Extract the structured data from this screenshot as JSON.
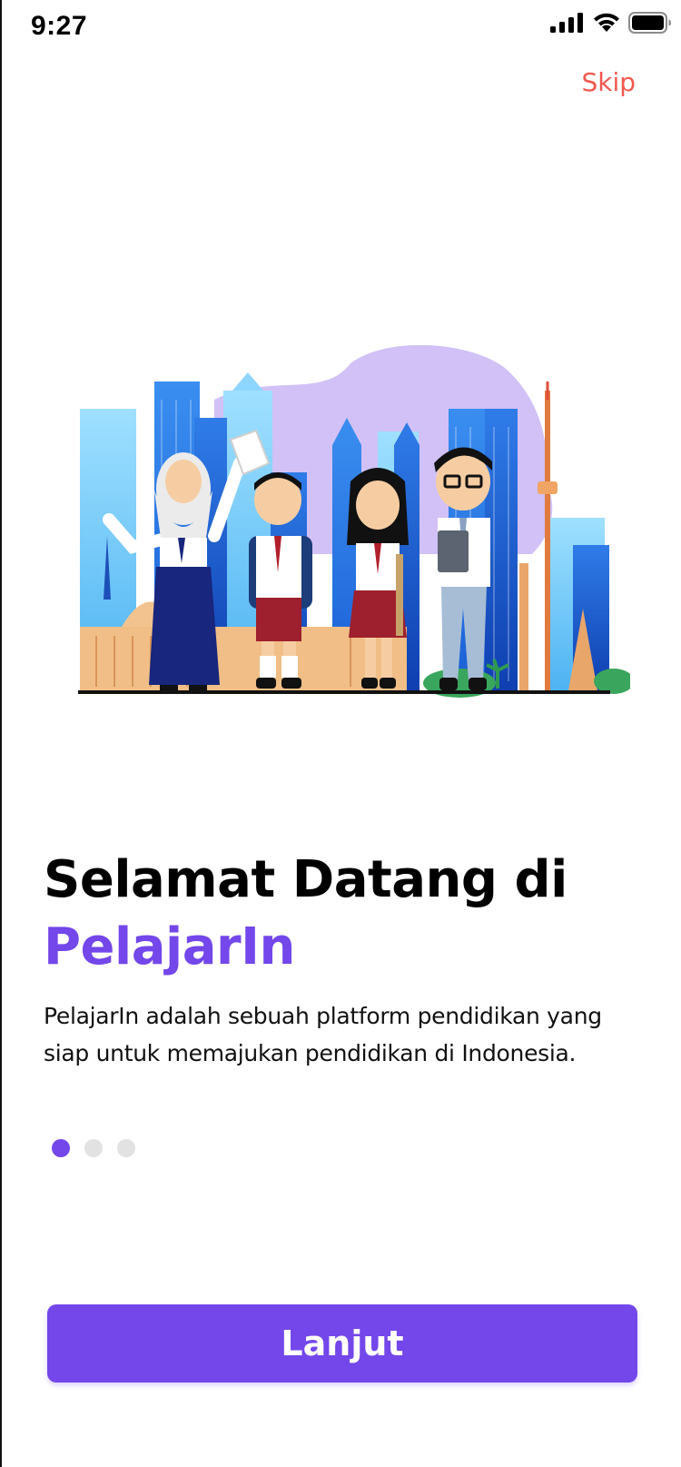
{
  "status_bar": {
    "time": "9:27",
    "signal_icon": "cellular-signal-icon",
    "wifi_icon": "wifi-icon",
    "battery_icon": "battery-icon"
  },
  "header": {
    "skip_label": "Skip",
    "skip_color": "#f0584f"
  },
  "illustration": {
    "icon": "students-city-illustration"
  },
  "onboarding": {
    "title_line1": "Selamat Datang di",
    "title_brand": "PelajarIn",
    "description": "PelajarIn adalah sebuah platform pendidikan yang siap untuk memajukan pendidikan di Indonesia.",
    "page_count": 3,
    "current_page": 1
  },
  "footer": {
    "next_label": "Lanjut"
  },
  "colors": {
    "accent": "#7347ea",
    "skip": "#f0584f",
    "dot_inactive": "#e2e2e2"
  }
}
